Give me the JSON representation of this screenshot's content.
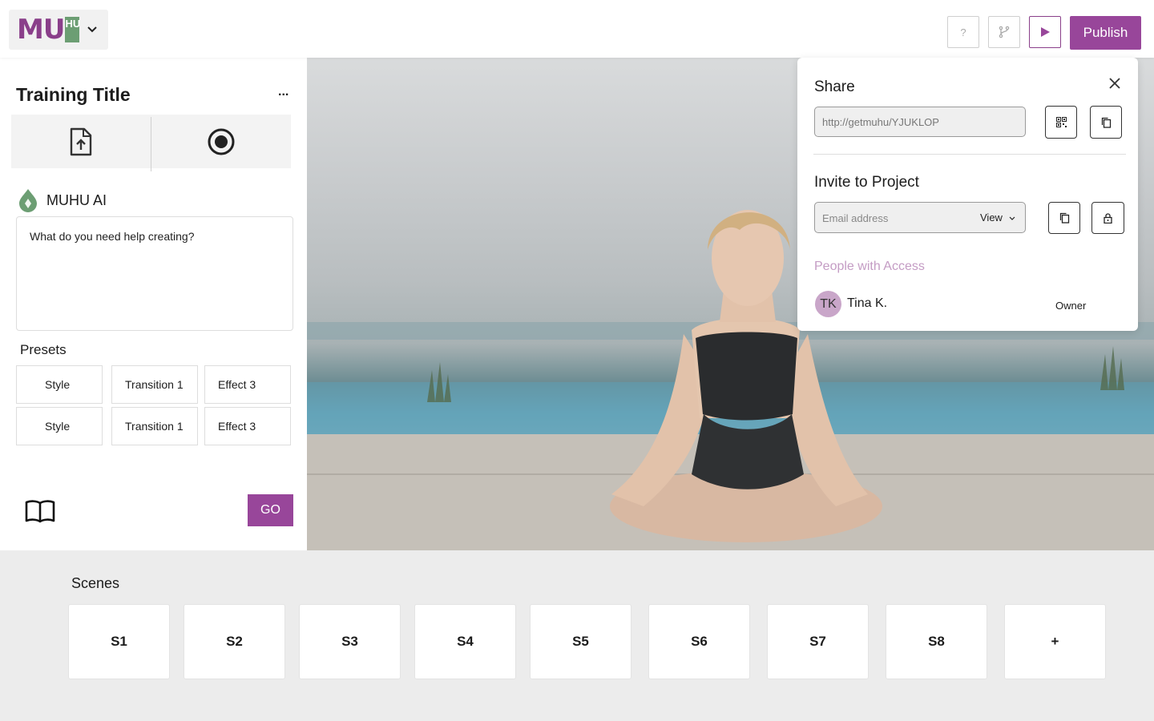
{
  "header": {
    "logo_text": "MU",
    "logo_tile_text": "HU",
    "help_label": "?",
    "publish_label": "Publish"
  },
  "sidebar": {
    "title": "Training Title",
    "more_label": "...",
    "ai_label": "MUHU AI",
    "prompt_placeholder": "What do you need help creating?",
    "presets_label": "Presets",
    "presets": [
      {
        "label": "Style"
      },
      {
        "label": "Transition 1"
      },
      {
        "label": "Effect 3"
      },
      {
        "label": "Style"
      },
      {
        "label": "Transition 1"
      },
      {
        "label": "Effect 3"
      }
    ],
    "go_label": "GO"
  },
  "share": {
    "title": "Share",
    "url": "http://getmuhu/YJUKLOP",
    "invite_title": "Invite to Project",
    "email_placeholder": "Email address",
    "permission": "View",
    "people_label": "People with Access",
    "people": [
      {
        "initials": "TK",
        "name": "Tina K.",
        "role": "Owner"
      }
    ]
  },
  "scenes": {
    "label": "Scenes",
    "items": [
      "S1",
      "S2",
      "S3",
      "S4",
      "S5",
      "S6",
      "S7",
      "S8",
      "+"
    ]
  },
  "colors": {
    "brand_purple": "#98469a",
    "brand_green": "#6c9e73"
  }
}
